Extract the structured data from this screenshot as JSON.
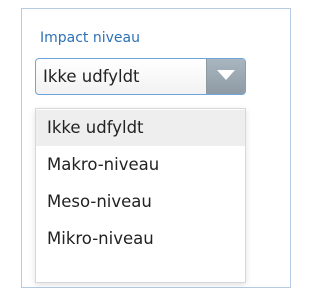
{
  "field": {
    "label": "Impact niveau",
    "selected_value": "Ikke udfyldt"
  },
  "dropdown": {
    "options": [
      {
        "label": "Ikke udfyldt",
        "selected": true
      },
      {
        "label": "Makro-niveau",
        "selected": false
      },
      {
        "label": "Meso-niveau",
        "selected": false
      },
      {
        "label": "Mikro-niveau",
        "selected": false
      }
    ]
  },
  "colors": {
    "label": "#2d72b5",
    "select_border": "#6fa5da",
    "button": "#9aa7b0",
    "selected_option_bg": "#eeeeee"
  },
  "icons": {
    "dropdown_toggle": "chevron-down-icon"
  }
}
